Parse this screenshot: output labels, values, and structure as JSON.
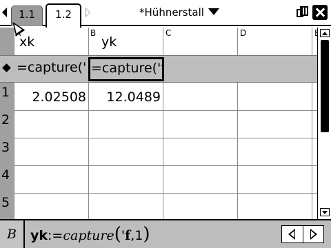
{
  "tabs": [
    {
      "label": "1.1",
      "active": false
    },
    {
      "label": "1.2",
      "active": true
    }
  ],
  "document": {
    "title": "*Hühnerstall"
  },
  "icons": {
    "nav_prev": "chevron-left-icon",
    "nav_next": "chevron-right-icon",
    "title_menu": "triangle-down-icon",
    "battery": "battery-icon",
    "close": "close-icon"
  },
  "columns": [
    {
      "letter": "A",
      "name": "xk",
      "formula": "=capture('"
    },
    {
      "letter": "B",
      "name": "yk",
      "formula": "=capture('f"
    },
    {
      "letter": "C",
      "name": "",
      "formula": ""
    },
    {
      "letter": "D",
      "name": "",
      "formula": ""
    },
    {
      "letter": "E",
      "name": "",
      "formula": ""
    }
  ],
  "rows": [
    {
      "num": "1",
      "cells": [
        "2.02508",
        "12.0489",
        "",
        ""
      ]
    },
    {
      "num": "2",
      "cells": [
        "",
        "",
        "",
        ""
      ]
    },
    {
      "num": "3",
      "cells": [
        "",
        "",
        "",
        ""
      ]
    },
    {
      "num": "4",
      "cells": [
        "",
        "",
        "",
        ""
      ]
    },
    {
      "num": "5",
      "cells": [
        "",
        "",
        "",
        ""
      ]
    }
  ],
  "entry_line": {
    "cell_ref": "B",
    "var": "yk",
    "assign": ":=",
    "function": "capture",
    "open_paren": "(",
    "arg_quote": "'",
    "arg_var": "f",
    "arg_rest": ",1",
    "close_paren": ")"
  }
}
